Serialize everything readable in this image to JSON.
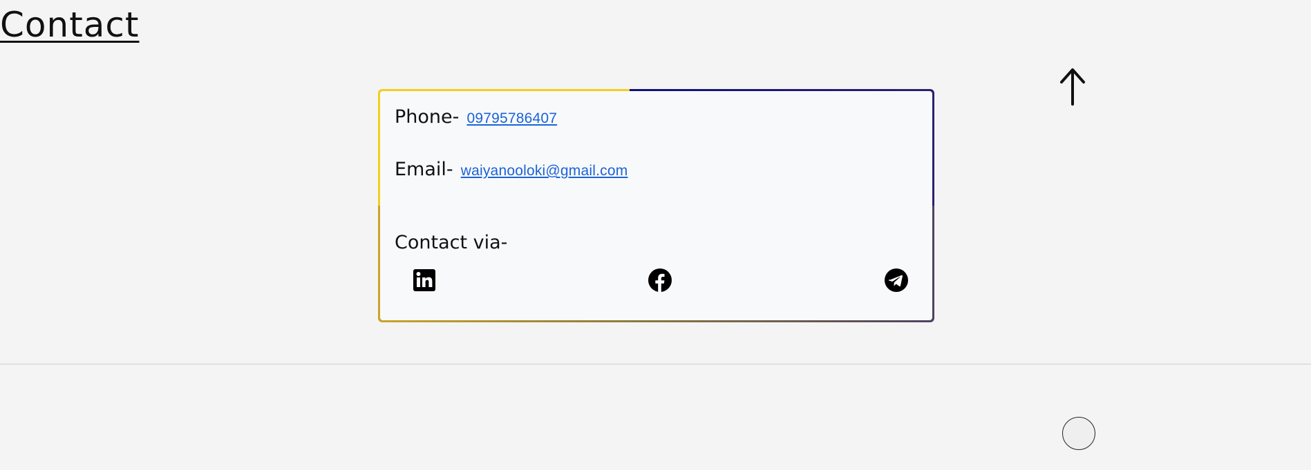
{
  "section": {
    "title": "Contact"
  },
  "card": {
    "phone_label": "Phone-",
    "phone_value": "09795786407",
    "email_label": "Email-",
    "email_value": "waiyanooloki@gmail.com",
    "contact_via_label": "Contact via-",
    "social_links": [
      {
        "name": "linkedin",
        "icon": "linkedin-icon"
      },
      {
        "name": "facebook",
        "icon": "facebook-icon"
      },
      {
        "name": "telegram",
        "icon": "telegram-icon"
      }
    ],
    "border_colors": {
      "top_left": "#f2cf1c",
      "top_right": "#101079",
      "bottom_left": "#c9a42a",
      "bottom_right": "#4e4262"
    }
  },
  "controls": {
    "scroll_top_icon": "arrow-up-icon",
    "theme_toggle_icon": "circle-icon"
  },
  "colors": {
    "background": "#f4f4f4",
    "link": "#1a63d6",
    "text": "#111111"
  }
}
